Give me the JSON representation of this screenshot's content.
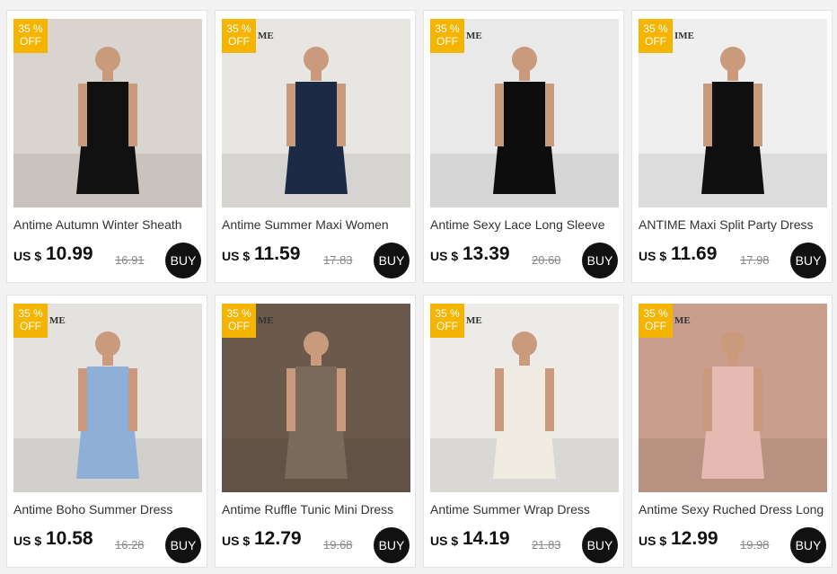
{
  "products": [
    {
      "badge_pct": "35 %",
      "badge_off": "OFF",
      "title": "Antime Autumn Winter Sheath",
      "currency": "US $",
      "price": "10.99",
      "old_price": "16.91",
      "buy": "BUY",
      "watermark": "",
      "dress_color": "#111111",
      "bg_color": "#d9d4cf"
    },
    {
      "badge_pct": "35 %",
      "badge_off": "OFF",
      "title": "Antime Summer Maxi Women",
      "currency": "US $",
      "price": "11.59",
      "old_price": "17.83",
      "buy": "BUY",
      "watermark": "ME",
      "dress_color": "#1c2a45",
      "bg_color": "#e8e6e2"
    },
    {
      "badge_pct": "35 %",
      "badge_off": "OFF",
      "title": "Antime Sexy Lace Long Sleeve",
      "currency": "US $",
      "price": "13.39",
      "old_price": "20.60",
      "buy": "BUY",
      "watermark": "ME",
      "dress_color": "#0d0d0d",
      "bg_color": "#e9e9e9"
    },
    {
      "badge_pct": "35 %",
      "badge_off": "OFF",
      "title": "ANTIME Maxi Split Party Dress",
      "currency": "US $",
      "price": "11.69",
      "old_price": "17.98",
      "buy": "BUY",
      "watermark": "IME",
      "dress_color": "#101010",
      "bg_color": "#efefef"
    },
    {
      "badge_pct": "35 %",
      "badge_off": "OFF",
      "title": "Antime Boho Summer Dress",
      "currency": "US $",
      "price": "10.58",
      "old_price": "16.28",
      "buy": "BUY",
      "watermark": "ME",
      "dress_color": "#8fb0d6",
      "bg_color": "#e4e2de"
    },
    {
      "badge_pct": "35 %",
      "badge_off": "OFF",
      "title": "Antime Ruffle Tunic Mini Dress",
      "currency": "US $",
      "price": "12.79",
      "old_price": "19.68",
      "buy": "BUY",
      "watermark": "ME",
      "dress_color": "#7a6a5a",
      "bg_color": "#6b5a4c"
    },
    {
      "badge_pct": "35 %",
      "badge_off": "OFF",
      "title": "Antime Summer Wrap Dress",
      "currency": "US $",
      "price": "14.19",
      "old_price": "21.83",
      "buy": "BUY",
      "watermark": "ME",
      "dress_color": "#f1ece2",
      "bg_color": "#ecebe8"
    },
    {
      "badge_pct": "35 %",
      "badge_off": "OFF",
      "title": "Antime Sexy Ruched Dress Long",
      "currency": "US $",
      "price": "12.99",
      "old_price": "19.98",
      "buy": "BUY",
      "watermark": "ME",
      "dress_color": "#e7b9b3",
      "bg_color": "#c99e8c"
    }
  ],
  "colors": {
    "badge": "#f5b400",
    "buy_button": "#111111",
    "page_bg": "#f2f2f2"
  }
}
